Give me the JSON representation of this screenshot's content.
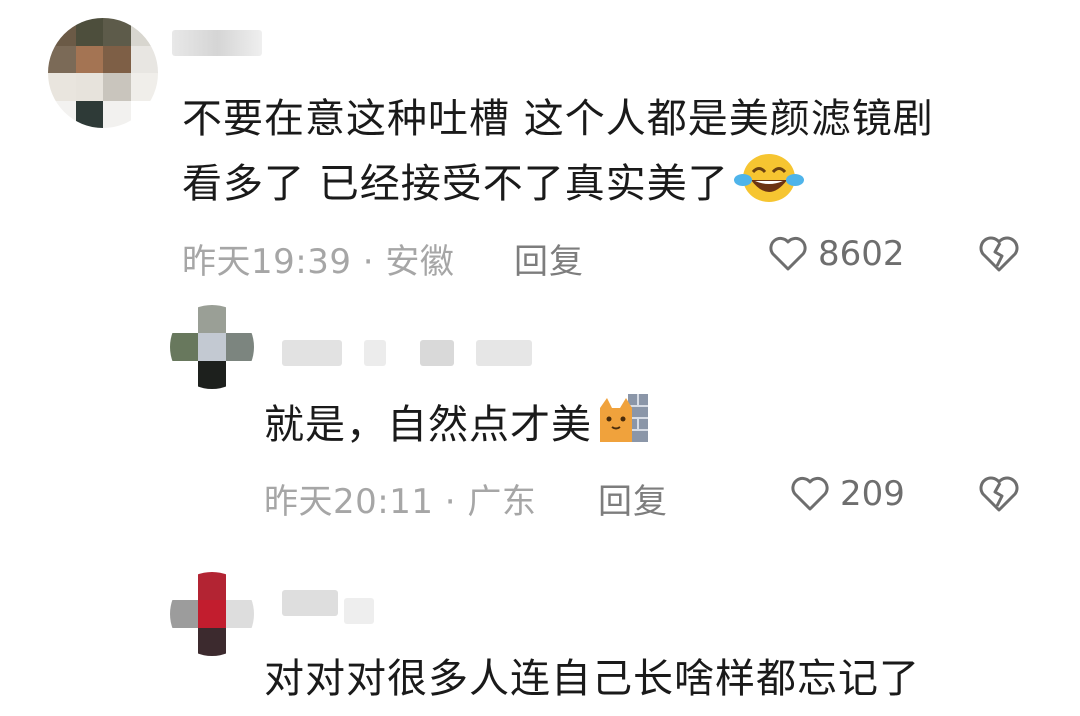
{
  "comments": [
    {
      "text_line1": "不要在意这种吐槽 这个人都是美颜滤镜剧",
      "text_line2": "看多了 已经接受不了真实美了",
      "emoji": "laughing-crying-emoji",
      "time": "昨天19:39",
      "separator": "·",
      "location": "安徽",
      "reply_label": "回复",
      "likes": "8602"
    },
    {
      "text": "就是，自然点才美",
      "emoji": "cat-peeking-emoji",
      "time": "昨天20:11",
      "separator": "·",
      "location": "广东",
      "reply_label": "回复",
      "likes": "209"
    },
    {
      "text": "对对对很多人连自己长啥样都忘记了"
    }
  ],
  "colors": {
    "text": "#1a1a1a",
    "meta": "#a6a6a6",
    "reply": "#7d7d7d",
    "like": "#6e6e6e"
  }
}
